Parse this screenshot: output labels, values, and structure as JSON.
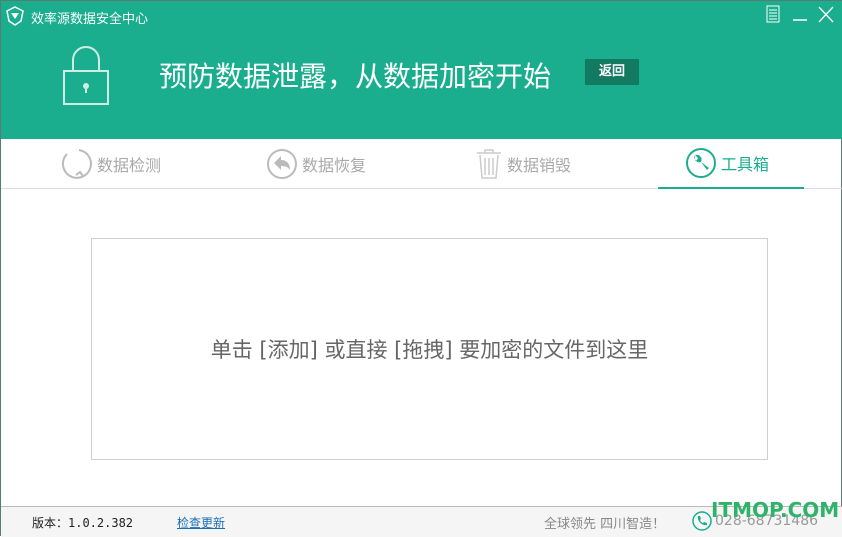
{
  "window": {
    "title": "效率源数据安全中心",
    "menu_icon": "menu-icon",
    "minimize_icon": "minimize-icon",
    "close_icon": "close-icon"
  },
  "banner": {
    "slogan": "预防数据泄露，从数据加密开始",
    "back_label": "返回",
    "icon": "lock-icon"
  },
  "tabs": [
    {
      "label": "数据检测",
      "icon": "refresh-icon"
    },
    {
      "label": "数据恢复",
      "icon": "undo-icon"
    },
    {
      "label": "数据销毁",
      "icon": "trash-icon"
    },
    {
      "label": "工具箱",
      "icon": "wrench-icon",
      "active": true
    }
  ],
  "dropzone": {
    "text": "单击 [添加] 或直接 [拖拽] 要加密的文件到这里"
  },
  "footer": {
    "version": "版本：1.0.2.382",
    "update_link": "检查更新",
    "slogan": "全球领先 四川智造！",
    "phone": "028-68731486"
  },
  "watermark": "ITMOP.COM",
  "colors": {
    "accent": "#1aae8f",
    "back_button": "#137a62",
    "link": "#1a6fb5"
  }
}
